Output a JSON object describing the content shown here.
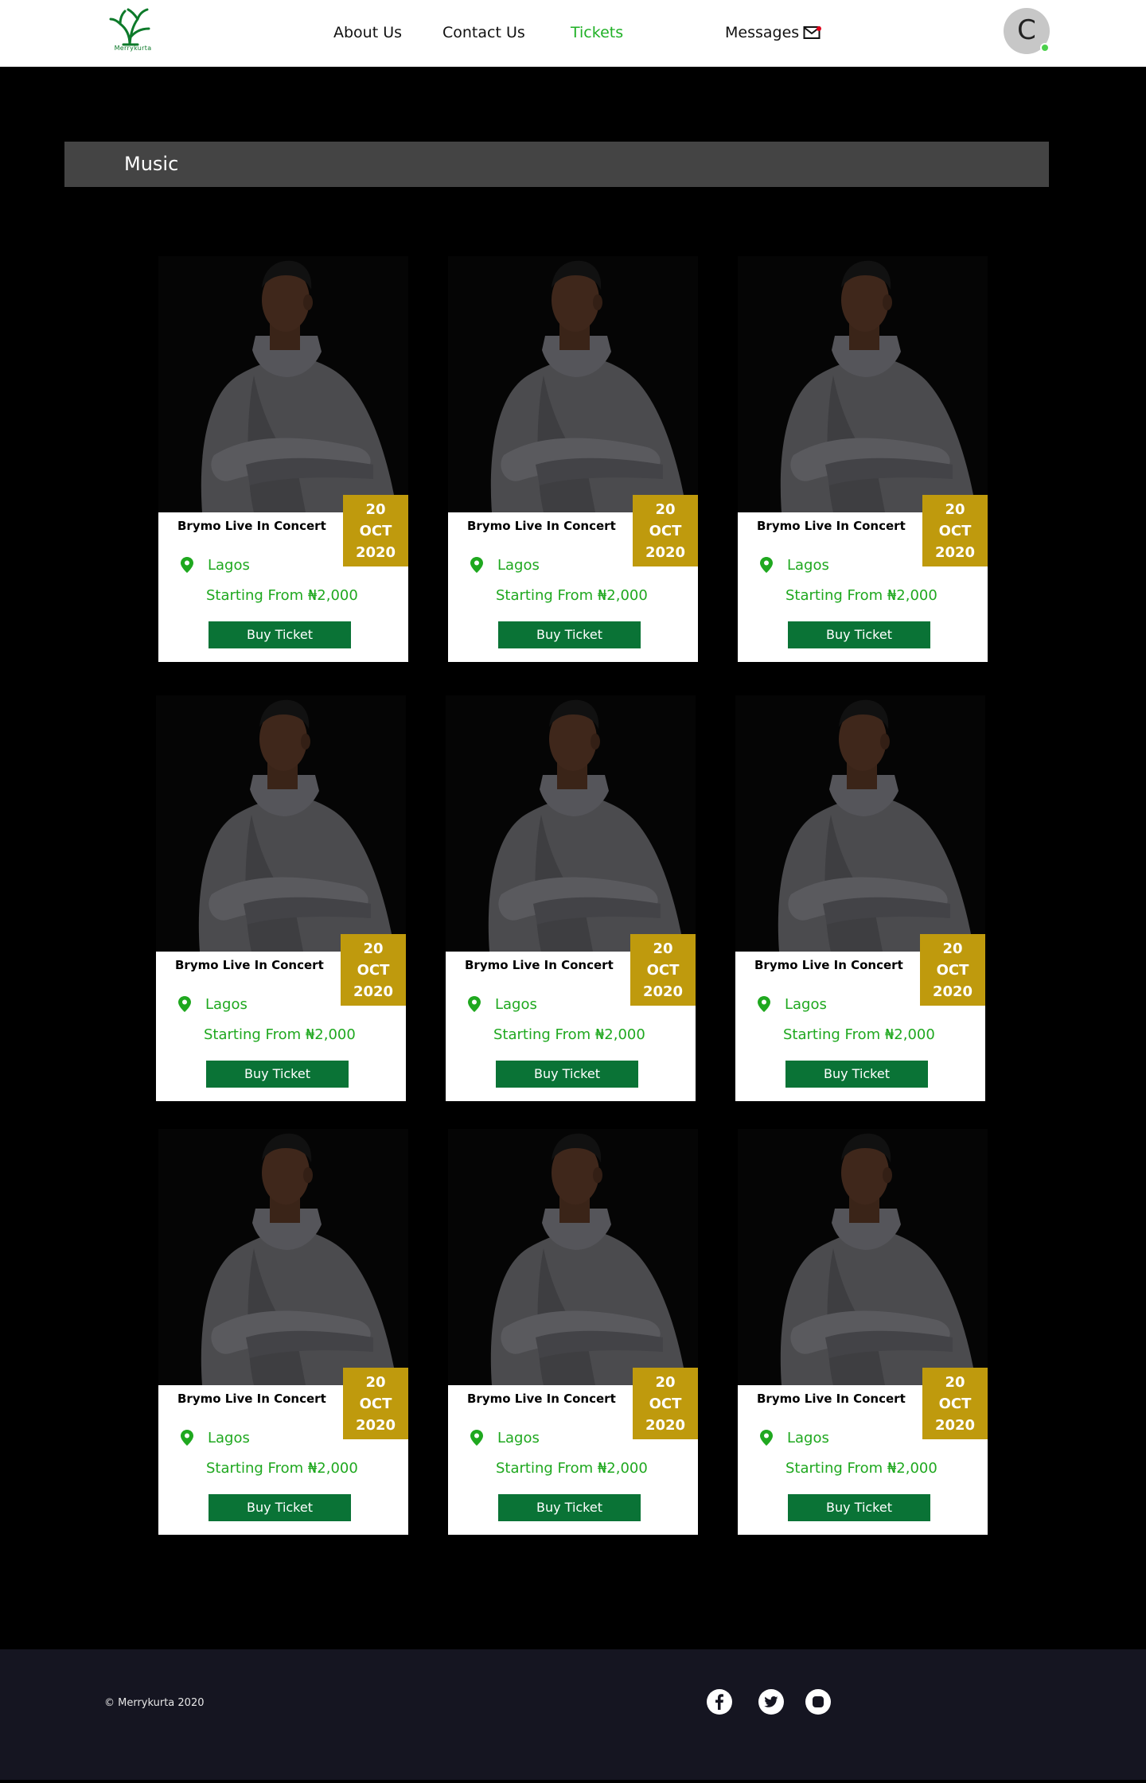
{
  "header": {
    "logo_text": "Merrykurta",
    "nav": {
      "about": "About Us",
      "contact": "Contact Us",
      "tickets": "Tickets",
      "messages": "Messages"
    },
    "avatar_initial": "C",
    "colors": {
      "active": "#1fb025",
      "notification": "#e0001b",
      "online": "#4cd04c"
    }
  },
  "section": {
    "title": "Music"
  },
  "events": [
    {
      "title": "Brymo Live In Concert",
      "day": "20",
      "month": "OCT",
      "year": "2020",
      "location": "Lagos",
      "price": "Starting From ₦2,000",
      "button": "Buy Ticket"
    },
    {
      "title": "Brymo Live In Concert",
      "day": "20",
      "month": "OCT",
      "year": "2020",
      "location": "Lagos",
      "price": "Starting From ₦2,000",
      "button": "Buy Ticket"
    },
    {
      "title": "Brymo Live In Concert",
      "day": "20",
      "month": "OCT",
      "year": "2020",
      "location": "Lagos",
      "price": "Starting From ₦2,000",
      "button": "Buy Ticket"
    },
    {
      "title": "Brymo Live In Concert",
      "day": "20",
      "month": "OCT",
      "year": "2020",
      "location": "Lagos",
      "price": "Starting From ₦2,000",
      "button": "Buy Ticket"
    },
    {
      "title": "Brymo Live In Concert",
      "day": "20",
      "month": "OCT",
      "year": "2020",
      "location": "Lagos",
      "price": "Starting From ₦2,000",
      "button": "Buy Ticket"
    },
    {
      "title": "Brymo Live In Concert",
      "day": "20",
      "month": "OCT",
      "year": "2020",
      "location": "Lagos",
      "price": "Starting From ₦2,000",
      "button": "Buy Ticket"
    },
    {
      "title": "Brymo Live In Concert",
      "day": "20",
      "month": "OCT",
      "year": "2020",
      "location": "Lagos",
      "price": "Starting From ₦2,000",
      "button": "Buy Ticket"
    },
    {
      "title": "Brymo Live In Concert",
      "day": "20",
      "month": "OCT",
      "year": "2020",
      "location": "Lagos",
      "price": "Starting From ₦2,000",
      "button": "Buy Ticket"
    },
    {
      "title": "Brymo Live In Concert",
      "day": "20",
      "month": "OCT",
      "year": "2020",
      "location": "Lagos",
      "price": "Starting From ₦2,000",
      "button": "Buy Ticket"
    }
  ],
  "colors": {
    "date_badge": "#bf9a0d",
    "button": "#0a7336",
    "location_text": "#1fa81f",
    "footer_bg": "#151521"
  },
  "footer": {
    "copyright": "© Merrykurta 2020",
    "social": [
      "facebook-icon",
      "twitter-icon",
      "instagram-icon"
    ]
  }
}
